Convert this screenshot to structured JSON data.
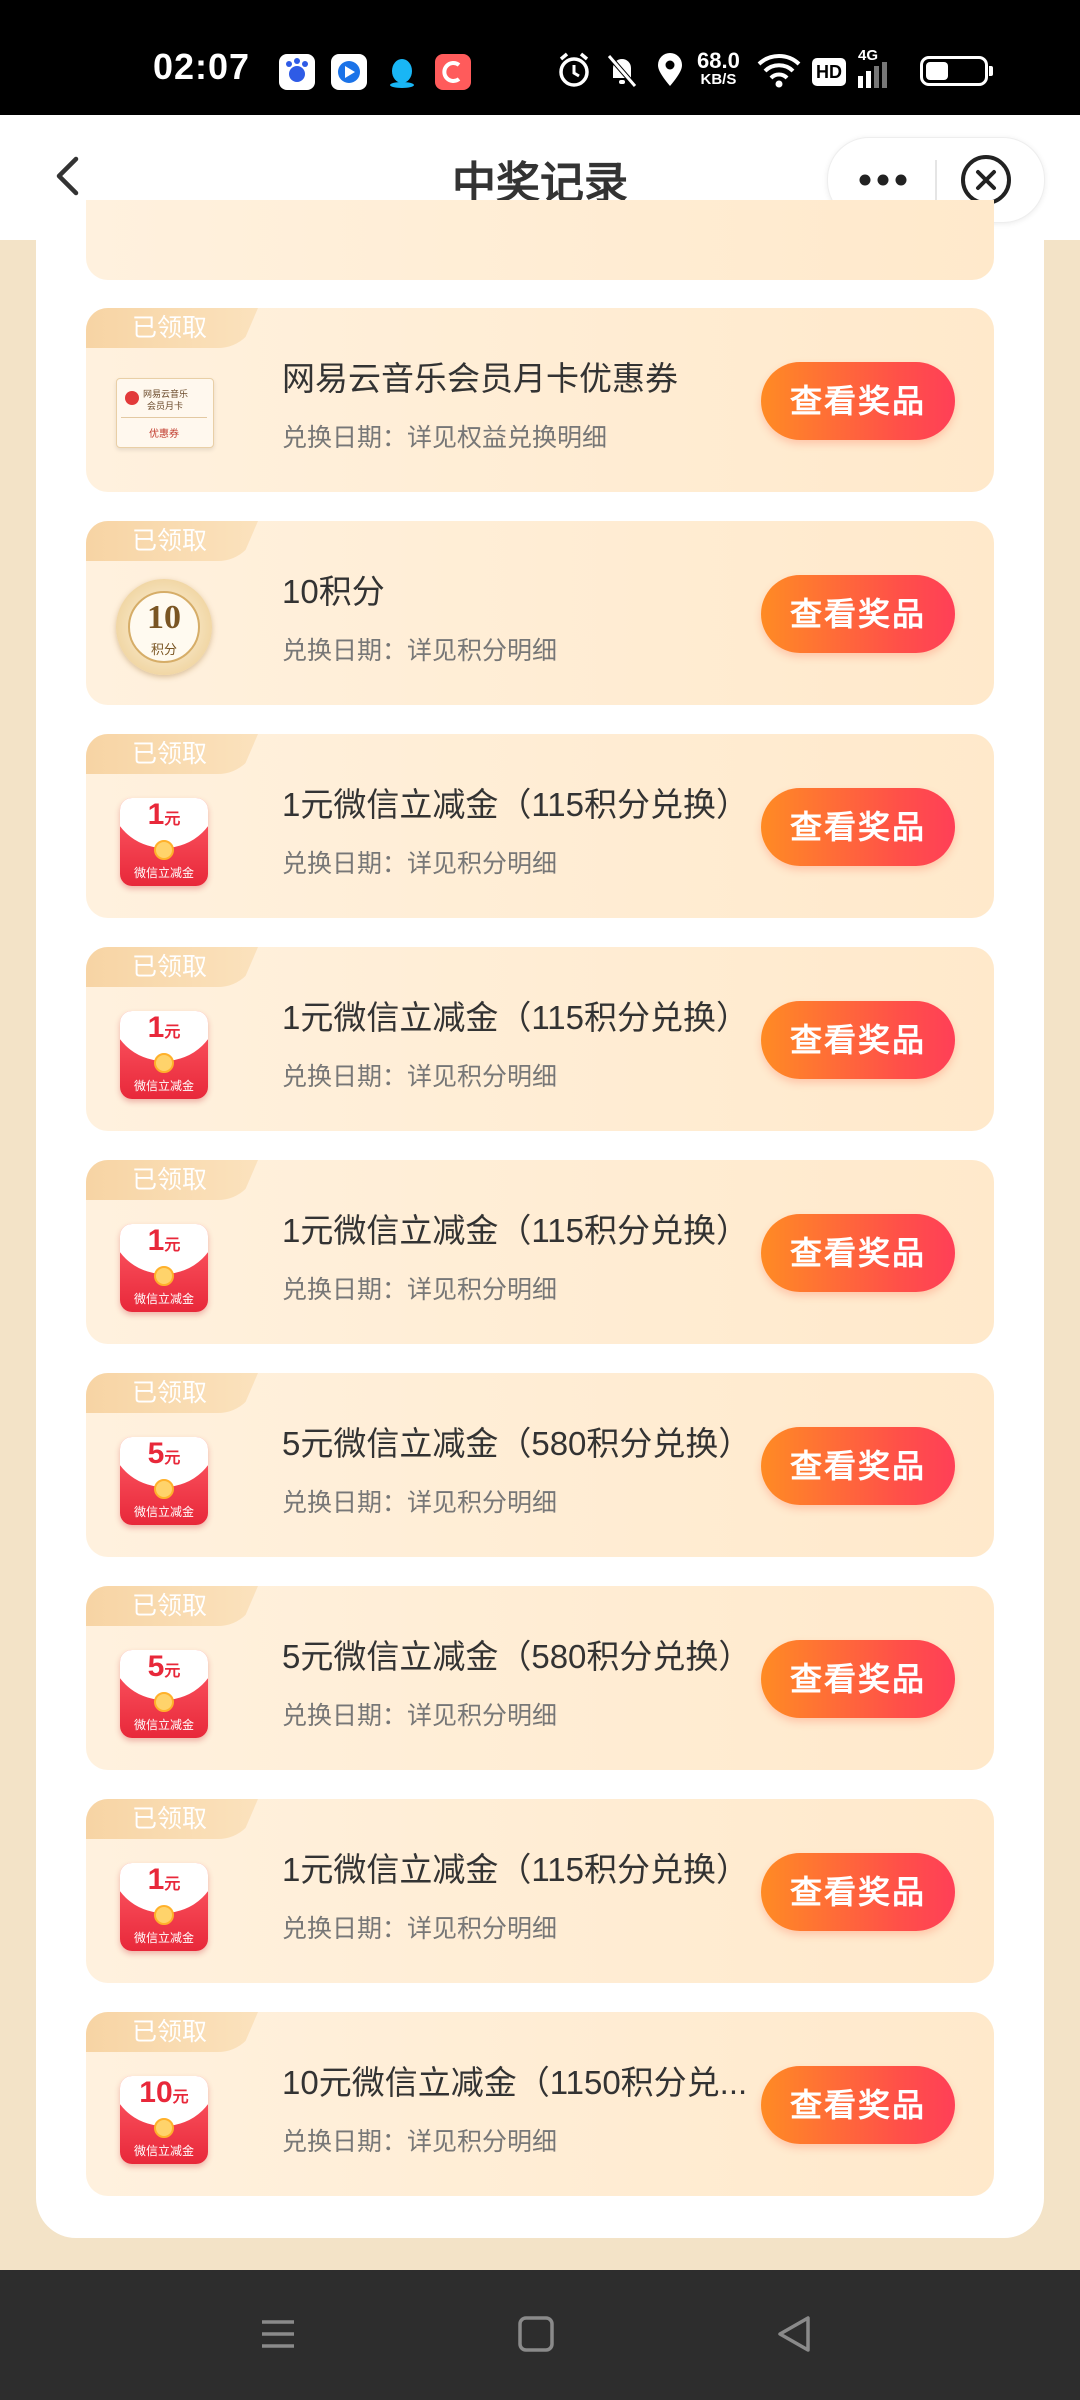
{
  "status_bar": {
    "time": "02:07",
    "apps": [
      "baidu-app-icon",
      "browser-app-icon",
      "qq-app-icon",
      "chat-app-icon"
    ],
    "net_speed_value": "68.0",
    "net_speed_unit": "KB/S",
    "hd_label": "HD",
    "network_type": "4G",
    "battery_percent": 40
  },
  "header": {
    "title": "中奖记录"
  },
  "records": [
    {
      "badge": "已领取",
      "icon": "netease-music-coupon-icon",
      "coupon_line1": "网易云音乐",
      "coupon_line2": "会员月卡",
      "coupon_tag": "优惠券",
      "name": "网易云音乐会员月卡优惠券",
      "date": "兑换日期：详见权益兑换明细",
      "button": "查看奖品"
    },
    {
      "badge": "已领取",
      "icon": "points-coin-icon",
      "coin_value": "10",
      "coin_unit": "积分",
      "name": "10积分",
      "date": "兑换日期：详见积分明细",
      "button": "查看奖品"
    },
    {
      "badge": "已领取",
      "icon": "wechat-red-packet-icon",
      "packet_value": "1",
      "packet_unit": "元",
      "packet_label": "微信立减金",
      "name": "1元微信立减金（115积分兑换）",
      "date": "兑换日期：详见积分明细",
      "button": "查看奖品"
    },
    {
      "badge": "已领取",
      "icon": "wechat-red-packet-icon",
      "packet_value": "1",
      "packet_unit": "元",
      "packet_label": "微信立减金",
      "name": "1元微信立减金（115积分兑换）",
      "date": "兑换日期：详见积分明细",
      "button": "查看奖品"
    },
    {
      "badge": "已领取",
      "icon": "wechat-red-packet-icon",
      "packet_value": "1",
      "packet_unit": "元",
      "packet_label": "微信立减金",
      "name": "1元微信立减金（115积分兑换）",
      "date": "兑换日期：详见积分明细",
      "button": "查看奖品"
    },
    {
      "badge": "已领取",
      "icon": "wechat-red-packet-icon",
      "packet_value": "5",
      "packet_unit": "元",
      "packet_label": "微信立减金",
      "name": "5元微信立减金（580积分兑换）",
      "date": "兑换日期：详见积分明细",
      "button": "查看奖品"
    },
    {
      "badge": "已领取",
      "icon": "wechat-red-packet-icon",
      "packet_value": "5",
      "packet_unit": "元",
      "packet_label": "微信立减金",
      "name": "5元微信立减金（580积分兑换）",
      "date": "兑换日期：详见积分明细",
      "button": "查看奖品"
    },
    {
      "badge": "已领取",
      "icon": "wechat-red-packet-icon",
      "packet_value": "1",
      "packet_unit": "元",
      "packet_label": "微信立减金",
      "name": "1元微信立减金（115积分兑换）",
      "date": "兑换日期：详见积分明细",
      "button": "查看奖品"
    },
    {
      "badge": "已领取",
      "icon": "wechat-red-packet-icon",
      "packet_value": "10",
      "packet_unit": "元",
      "packet_label": "微信立减金",
      "name": "10元微信立减金（1150积分兑...",
      "date": "兑换日期：详见积分明细",
      "button": "查看奖品"
    }
  ],
  "colors": {
    "page_background": "#f3e3c7",
    "card_background": "#fff1de",
    "button_start": "#ff8b24",
    "button_end": "#ff3f57",
    "badge": "#f7d4a4",
    "packet_red": "#e8283a"
  }
}
